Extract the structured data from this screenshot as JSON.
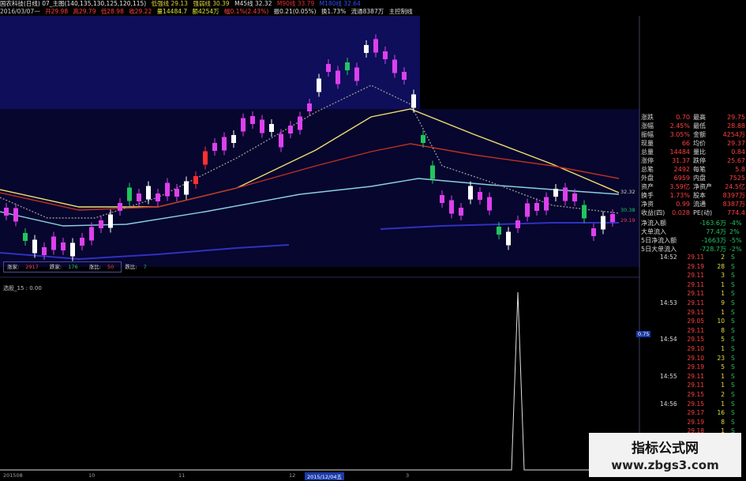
{
  "colors": {
    "up": "#dd40ee",
    "down": "#ffffff",
    "green": "#22c55e",
    "red": "#ff3030",
    "yellow": "#f0e070",
    "cyan": "#8ad0e0",
    "darkred": "#c03020",
    "blue": "#3030c0"
  },
  "top_info": {
    "line1": [
      "国农科技(日线) 07_主图(140,135,130,125,120,115)",
      "低强线 29.13",
      "强弱线 30.39",
      "M45线 32.32",
      "M90线 33.79",
      "M180线 32.64"
    ],
    "line2": [
      "2016/03/07一",
      "开29.98",
      "高29.79",
      "低28.98",
      "收29.22",
      "量14484.7",
      "额4254万",
      "幅0.1%(2.43%)",
      "振0.21(0.05%)",
      "换1.73%",
      "流通8387万",
      "主控制线"
    ]
  },
  "legend": [
    {
      "label": "涨家:",
      "value": "2917"
    },
    {
      "label": "跌家:",
      "value": "176"
    },
    {
      "label": "涨比:",
      "value": "50"
    },
    {
      "label": "跌比:",
      "value": "7"
    }
  ],
  "lower_label": "选股_15 : 0.00",
  "y_labels": {
    "l1": "32.32",
    "l2": "30.38",
    "l3": "29.19",
    "l4": "0.75"
  },
  "dates": [
    "201508",
    "10",
    "11",
    "12",
    "2015/12/04五",
    "3"
  ],
  "quote": [
    {
      "l": "涨跌",
      "v": "0.70",
      "l2": "最高",
      "v2": "29.75"
    },
    {
      "l": "涨幅",
      "v": "2.45%",
      "l2": "最低",
      "v2": "28.88"
    },
    {
      "l": "振幅",
      "v": "3.05%",
      "l2": "金额",
      "v2": "4254万"
    },
    {
      "l": "现量",
      "v": "66",
      "l2": "均价",
      "v2": "29.37"
    },
    {
      "l": "总量",
      "v": "14484",
      "l2": "量比",
      "v2": "0.84"
    },
    {
      "l": "涨停",
      "v": "31.37",
      "l2": "跌停",
      "v2": "25.67"
    },
    {
      "l": "总笔",
      "v": "2492",
      "l2": "每笔",
      "v2": "5.8"
    },
    {
      "l": "外盘",
      "v": "6959",
      "l2": "内盘",
      "v2": "7525"
    },
    {
      "l": "资产",
      "v": "3.59亿",
      "l2": "净资产",
      "v2": "24.5亿"
    },
    {
      "l": "换手",
      "v": "1.73%",
      "l2": "股本",
      "v2": "8397万"
    },
    {
      "l": "净资",
      "v": "0.99",
      "l2": "流通",
      "v2": "8387万"
    },
    {
      "l": "收益(四)",
      "v": "0.028",
      "l2": "PE(动)",
      "v2": "774.4"
    }
  ],
  "flows": [
    {
      "l": "净流入额",
      "v": "-163.6万",
      "p": "-4%"
    },
    {
      "l": "大单流入",
      "v": "77.4万",
      "p": "2%"
    },
    {
      "l": "5日净流入额",
      "v": "-1663万",
      "p": "-5%"
    },
    {
      "l": "5日大单流入",
      "v": "-728.7万",
      "p": "-2%"
    }
  ],
  "ticks": [
    {
      "time": "14:52",
      "price": "29.11",
      "vol": "2",
      "side": "S"
    },
    {
      "time": "",
      "price": "29.19",
      "vol": "28",
      "side": "S"
    },
    {
      "time": "",
      "price": "29.11",
      "vol": "3",
      "side": "S"
    },
    {
      "time": "",
      "price": "29.11",
      "vol": "1",
      "side": "S"
    },
    {
      "time": "",
      "price": "29.11",
      "vol": "1",
      "side": "S"
    },
    {
      "time": "14:53",
      "price": "29.11",
      "vol": "9",
      "side": "S"
    },
    {
      "time": "",
      "price": "29.11",
      "vol": "1",
      "side": "S"
    },
    {
      "time": "",
      "price": "29.05",
      "vol": "10",
      "side": "S"
    },
    {
      "time": "",
      "price": "29.11",
      "vol": "8",
      "side": "S"
    },
    {
      "time": "14:54",
      "price": "29.15",
      "vol": "5",
      "side": "S"
    },
    {
      "time": "",
      "price": "29.10",
      "vol": "1",
      "side": "S"
    },
    {
      "time": "",
      "price": "29.10",
      "vol": "23",
      "side": "S"
    },
    {
      "time": "",
      "price": "29.19",
      "vol": "5",
      "side": "S"
    },
    {
      "time": "14:55",
      "price": "29.11",
      "vol": "1",
      "side": "S"
    },
    {
      "time": "",
      "price": "29.11",
      "vol": "1",
      "side": "S"
    },
    {
      "time": "",
      "price": "29.15",
      "vol": "2",
      "side": "S"
    },
    {
      "time": "14:56",
      "price": "29.15",
      "vol": "1",
      "side": "S"
    },
    {
      "time": "",
      "price": "29.17",
      "vol": "16",
      "side": "S"
    },
    {
      "time": "",
      "price": "29.19",
      "vol": "8",
      "side": "S"
    },
    {
      "time": "",
      "price": "29.18",
      "vol": "1",
      "side": "S"
    },
    {
      "time": "",
      "price": "29.11",
      "vol": "1",
      "side": "S"
    },
    {
      "time": "",
      "price": "29.11",
      "vol": "1",
      "side": "S"
    }
  ],
  "watermark": {
    "a": "指标公式网",
    "b": "www.zbgs3.com"
  }
}
